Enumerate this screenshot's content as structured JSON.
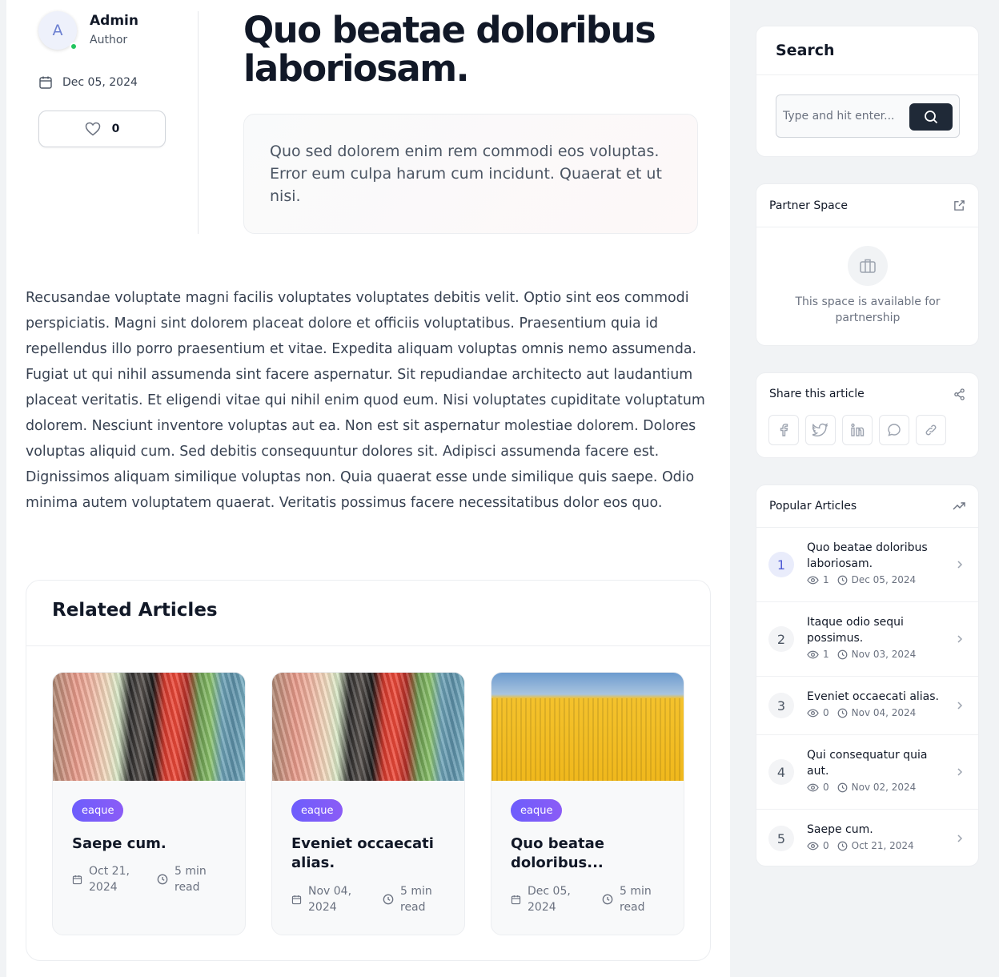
{
  "author": {
    "initial": "A",
    "name": "Admin",
    "role": "Author",
    "date": "Dec 05, 2024",
    "likes": "0"
  },
  "article": {
    "title": "Quo beatae doloribus laboriosam.",
    "excerpt": "Quo sed dolorem enim rem commodi eos voluptas. Error eum culpa harum cum incidunt. Quaerat et ut nisi.",
    "body": "Recusandae voluptate magni facilis voluptates voluptates debitis velit. Optio sint eos commodi perspiciatis. Magni sint dolorem placeat dolore et officiis voluptatibus. Praesentium quia id repellendus illo porro praesentium et vitae. Expedita aliquam voluptas omnis nemo assumenda. Fugiat ut qui nihil assumenda sint facere aspernatur. Sit repudiandae architecto aut laudantium placeat veritatis. Et eligendi vitae qui nihil enim quod eum. Nisi voluptates cupiditate voluptatum dolorem. Nesciunt inventore voluptas aut ea. Non est sit aspernatur molestiae dolorem. Dolores voluptas aliquid cum. Sed debitis consequuntur dolores sit. Adipisci assumenda facere est. Dignissimos aliquam similique voluptas non. Quia quaerat esse unde similique quis saepe. Odio minima autem voluptatem quaerat. Veritatis possimus facere necessitatibus dolor eos quo."
  },
  "related": {
    "heading": "Related Articles",
    "cards": [
      {
        "tag": "eaque",
        "title": "Saepe cum.",
        "date": "Oct 21, 2024",
        "read": "5 min read",
        "image": "colorful-wires"
      },
      {
        "tag": "eaque",
        "title": "Eveniet occaecati alias.",
        "date": "Nov 04, 2024",
        "read": "5 min read",
        "image": "colorful-wires"
      },
      {
        "tag": "eaque",
        "title": "Quo beatae doloribus...",
        "date": "Dec 05, 2024",
        "read": "5 min read",
        "image": "yellow-building"
      }
    ]
  },
  "sidebar": {
    "search": {
      "title": "Search",
      "placeholder": "Type and hit enter..."
    },
    "partner": {
      "title": "Partner Space",
      "text": "This space is available for partnership"
    },
    "share": {
      "title": "Share this article",
      "buttons": [
        "facebook-icon",
        "twitter-icon",
        "linkedin-icon",
        "chat-icon",
        "link-icon"
      ]
    },
    "popular": {
      "title": "Popular Articles",
      "items": [
        {
          "num": "1",
          "title": "Quo beatae doloribus laboriosam.",
          "views": "1",
          "date": "Dec 05, 2024"
        },
        {
          "num": "2",
          "title": "Itaque odio sequi possimus.",
          "views": "1",
          "date": "Nov 03, 2024"
        },
        {
          "num": "3",
          "title": "Eveniet occaecati alias.",
          "views": "0",
          "date": "Nov 04, 2024"
        },
        {
          "num": "4",
          "title": "Qui consequatur quia aut.",
          "views": "0",
          "date": "Nov 02, 2024"
        },
        {
          "num": "5",
          "title": "Saepe cum.",
          "views": "0",
          "date": "Oct 21, 2024"
        }
      ]
    }
  },
  "colors": {
    "accent": "#6d5dfc",
    "dark": "#1f2937",
    "online": "#22c55e"
  }
}
